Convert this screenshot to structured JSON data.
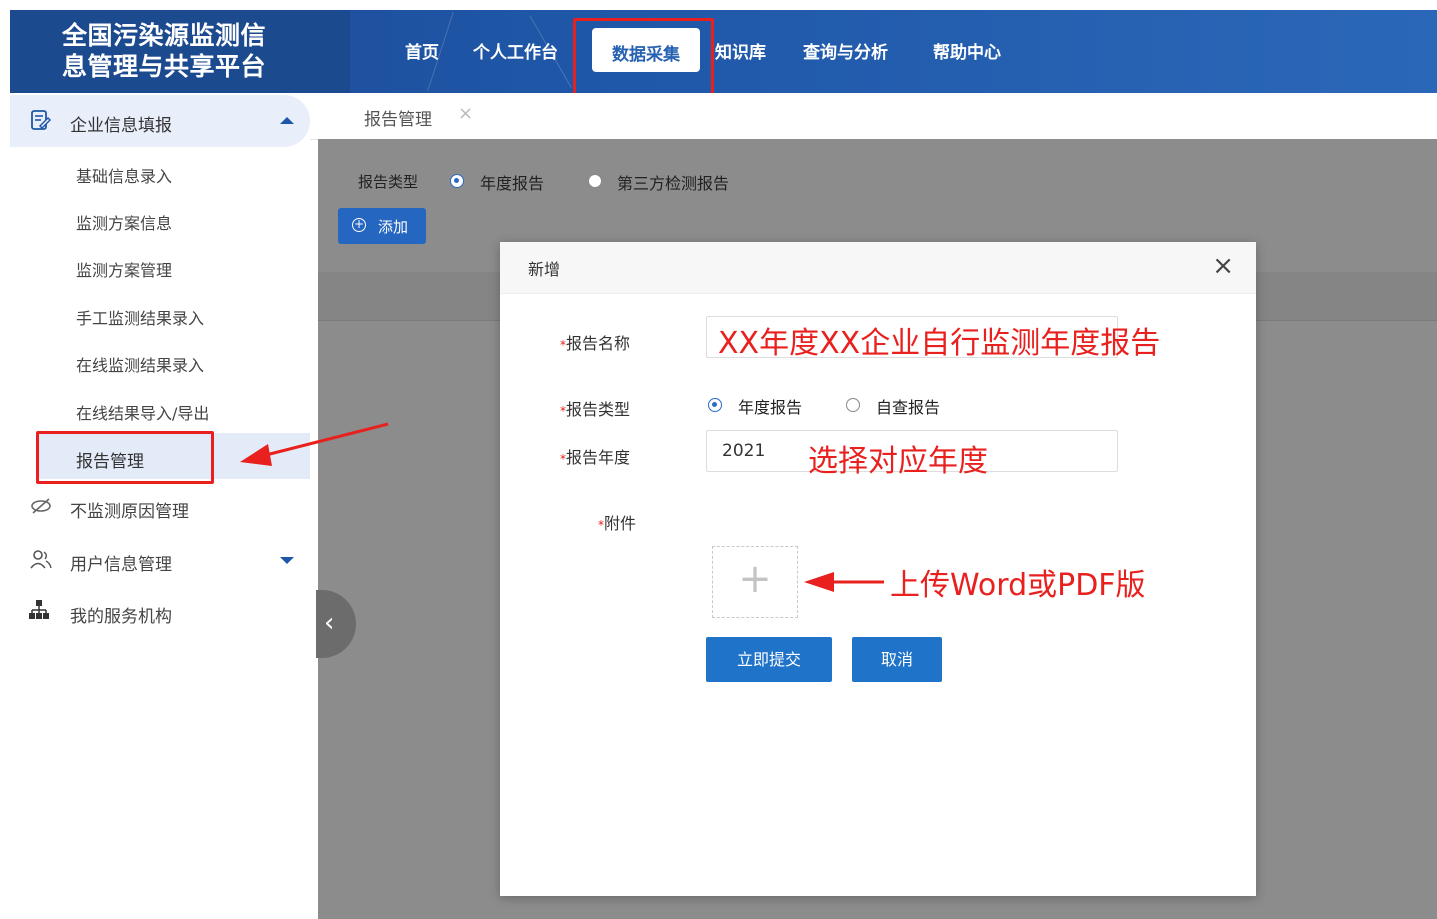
{
  "header": {
    "title_line1": "全国污染源监测信",
    "title_line2": "息管理与共享平台",
    "nav": [
      "首页",
      "个人工作台",
      "数据采集",
      "知识库",
      "查询与分析",
      "帮助中心"
    ],
    "active_nav": "数据采集"
  },
  "sidebar": {
    "group_label": "企业信息填报",
    "sub_items": [
      "基础信息录入",
      "监测方案信息",
      "监测方案管理",
      "手工监测结果录入",
      "在线监测结果录入",
      "在线结果导入/导出",
      "报告管理"
    ],
    "items": [
      "不监测原因管理",
      "用户信息管理",
      "我的服务机构"
    ]
  },
  "tabs": {
    "current": "报告管理",
    "close": "×"
  },
  "filter": {
    "label": "报告类型",
    "options": [
      "年度报告",
      "第三方检测报告"
    ],
    "add_label": "添加",
    "selected": "年度报告"
  },
  "modal": {
    "title": "新增",
    "close": "×",
    "fields": {
      "report_name_label": "报告名称",
      "report_type_label": "报告类型",
      "report_type_options": [
        "年度报告",
        "自查报告"
      ],
      "report_type_selected": "年度报告",
      "report_year_label": "报告年度",
      "report_year_value": "2021",
      "attachment_label": "附件",
      "required_mark": "*"
    },
    "submit_label": "立即提交",
    "cancel_label": "取消"
  },
  "annotations": {
    "report_name_hint": "XX年度XX企业自行监测年度报告",
    "year_hint": "选择对应年度",
    "upload_hint": "上传Word或PDF版"
  },
  "colors": {
    "header_blue": "#1f57a8",
    "highlight_red": "#e8211f",
    "button_blue": "#1f73c8"
  },
  "icons": [
    "form-icon",
    "eye-off-icon",
    "users-icon",
    "org-chart-icon",
    "plus-icon",
    "close-icon",
    "chevron-left-icon"
  ]
}
